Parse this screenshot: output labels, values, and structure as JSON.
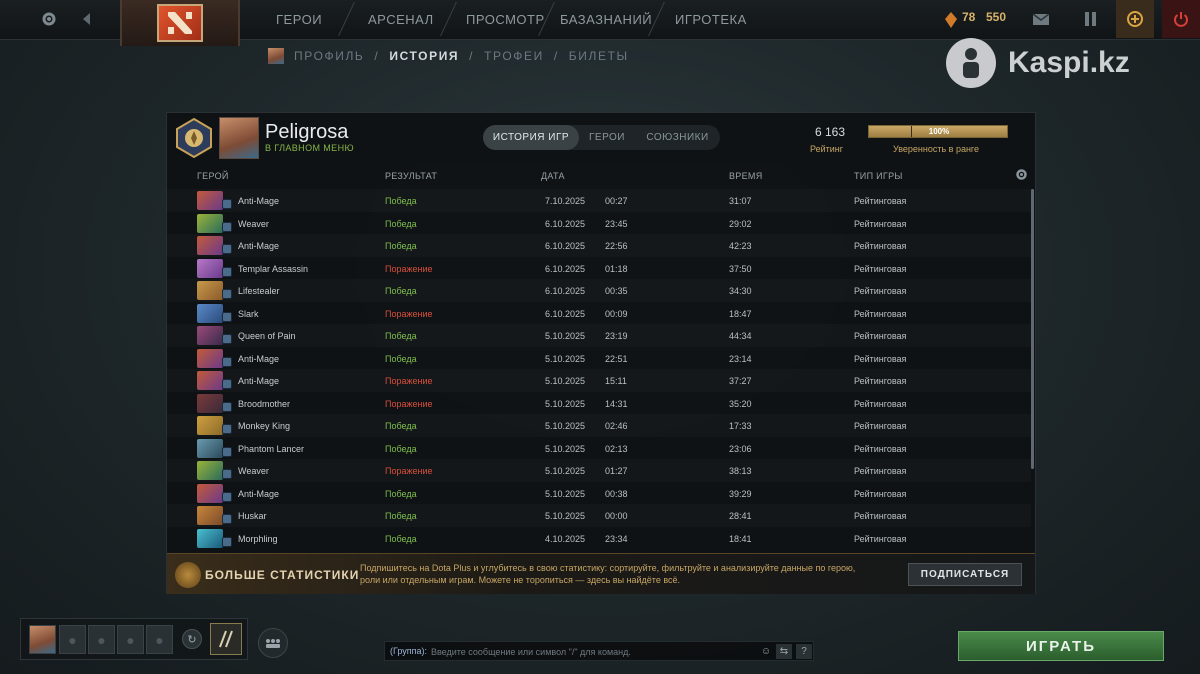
{
  "topbar": {
    "nav": [
      "ГЕРОИ",
      "АРСЕНАЛ",
      "ПРОСМОТР",
      "БАЗАЗНАНИЙ",
      "ИГРОТЕКА"
    ],
    "currency_a": "78",
    "currency_b": "550",
    "icons": [
      "gear-icon",
      "arrow-left-icon",
      "dota-logo-icon",
      "mail-icon",
      "shield-icon",
      "plus-icon",
      "power-icon"
    ]
  },
  "subnav": {
    "items": [
      "ПРОФИЛЬ",
      "ИСТОРИЯ",
      "ТРОФЕИ",
      "БИЛЕТЫ"
    ],
    "active": "ИСТОРИЯ"
  },
  "watermark": {
    "text": "Kaspi.kz"
  },
  "profile": {
    "name": "Peligrosa",
    "status": "В ГЛАВНОМ МЕНЮ",
    "tabs": [
      "ИСТОРИЯ ИГР",
      "ГЕРОИ",
      "СОЮЗНИКИ"
    ],
    "active_tab": "ИСТОРИЯ ИГР",
    "rating_value": "6 163",
    "rating_label": "Рейтинг",
    "confidence_value": "100%",
    "confidence_fraction": 1.0,
    "confidence_label": "Уверенность в ранге"
  },
  "table": {
    "columns": {
      "hero": "ГЕРОЙ",
      "result": "РЕЗУЛЬТАТ",
      "date": "ДАТА",
      "duration": "ВРЕМЯ",
      "type": "ТИП ИГРЫ"
    },
    "rows": [
      {
        "hero": "Anti-Mage",
        "result": "Победа",
        "win": true,
        "date": "7.10.2025",
        "time": "00:27",
        "duration": "31:07",
        "type": "Рейтинговая"
      },
      {
        "hero": "Weaver",
        "result": "Победа",
        "win": true,
        "date": "6.10.2025",
        "time": "23:45",
        "duration": "29:02",
        "type": "Рейтинговая"
      },
      {
        "hero": "Anti-Mage",
        "result": "Победа",
        "win": true,
        "date": "6.10.2025",
        "time": "22:56",
        "duration": "42:23",
        "type": "Рейтинговая"
      },
      {
        "hero": "Templar Assassin",
        "result": "Поражение",
        "win": false,
        "date": "6.10.2025",
        "time": "01:18",
        "duration": "37:50",
        "type": "Рейтинговая"
      },
      {
        "hero": "Lifestealer",
        "result": "Победа",
        "win": true,
        "date": "6.10.2025",
        "time": "00:35",
        "duration": "34:30",
        "type": "Рейтинговая"
      },
      {
        "hero": "Slark",
        "result": "Поражение",
        "win": false,
        "date": "6.10.2025",
        "time": "00:09",
        "duration": "18:47",
        "type": "Рейтинговая"
      },
      {
        "hero": "Queen of Pain",
        "result": "Победа",
        "win": true,
        "date": "5.10.2025",
        "time": "23:19",
        "duration": "44:34",
        "type": "Рейтинговая"
      },
      {
        "hero": "Anti-Mage",
        "result": "Победа",
        "win": true,
        "date": "5.10.2025",
        "time": "22:51",
        "duration": "23:14",
        "type": "Рейтинговая"
      },
      {
        "hero": "Anti-Mage",
        "result": "Поражение",
        "win": false,
        "date": "5.10.2025",
        "time": "15:11",
        "duration": "37:27",
        "type": "Рейтинговая"
      },
      {
        "hero": "Broodmother",
        "result": "Поражение",
        "win": false,
        "date": "5.10.2025",
        "time": "14:31",
        "duration": "35:20",
        "type": "Рейтинговая"
      },
      {
        "hero": "Monkey King",
        "result": "Победа",
        "win": true,
        "date": "5.10.2025",
        "time": "02:46",
        "duration": "17:33",
        "type": "Рейтинговая"
      },
      {
        "hero": "Phantom Lancer",
        "result": "Победа",
        "win": true,
        "date": "5.10.2025",
        "time": "02:13",
        "duration": "23:06",
        "type": "Рейтинговая"
      },
      {
        "hero": "Weaver",
        "result": "Поражение",
        "win": false,
        "date": "5.10.2025",
        "time": "01:27",
        "duration": "38:13",
        "type": "Рейтинговая"
      },
      {
        "hero": "Anti-Mage",
        "result": "Победа",
        "win": true,
        "date": "5.10.2025",
        "time": "00:38",
        "duration": "39:29",
        "type": "Рейтинговая"
      },
      {
        "hero": "Huskar",
        "result": "Победа",
        "win": true,
        "date": "5.10.2025",
        "time": "00:00",
        "duration": "28:41",
        "type": "Рейтинговая"
      },
      {
        "hero": "Morphling",
        "result": "Победа",
        "win": true,
        "date": "4.10.2025",
        "time": "23:34",
        "duration": "18:41",
        "type": "Рейтинговая"
      }
    ]
  },
  "banner": {
    "title": "БОЛЬШЕ СТАТИСТИКИ",
    "text": "Подпишитесь на Dota Plus и углубитесь в свою статистику: сортируйте, фильтруйте и анализируйте данные по герою, роли или отдельным играм. Можете не торопиться — здесь вы найдёте всё.",
    "button": "ПОДПИСАТЬСЯ"
  },
  "bottom": {
    "chat_label": "(Группа):",
    "chat_placeholder": "Введите сообщение или символ \"/\" для команд.",
    "help": "?",
    "play": "ИГРАТЬ"
  },
  "colors": {
    "win": "#7fbf4d",
    "loss": "#d84f3c",
    "gold": "#c7a665",
    "play": "#3a7a3e"
  }
}
